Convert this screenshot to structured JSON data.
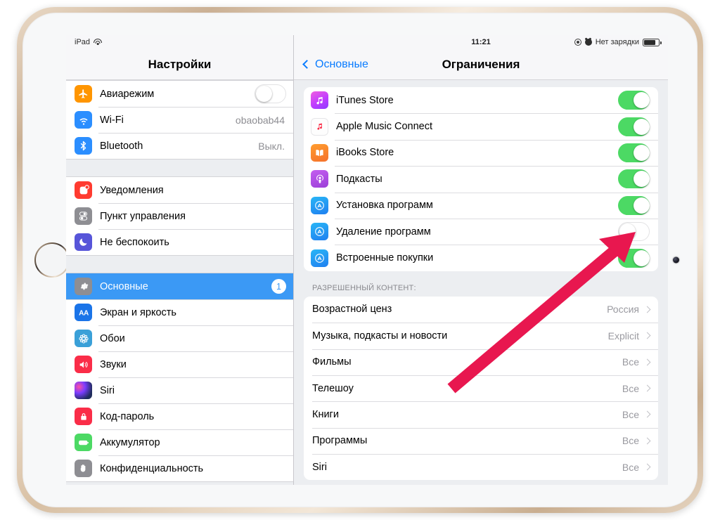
{
  "device": {
    "home_button": "home-button",
    "camera": "front-camera"
  },
  "sidebar": {
    "statusbar": {
      "device_label": "iPad",
      "wifi_icon": "wifi-icon"
    },
    "title": "Настройки",
    "groups": [
      {
        "rows": [
          {
            "label": "Авиарежим",
            "icon": "airplane-icon",
            "control": "toggle",
            "toggle_on": false
          },
          {
            "label": "Wi-Fi",
            "icon": "wifi-icon",
            "control": "value",
            "value": "obaobab44"
          },
          {
            "label": "Bluetooth",
            "icon": "bluetooth-icon",
            "control": "value",
            "value": "Выкл."
          }
        ]
      },
      {
        "rows": [
          {
            "label": "Уведомления",
            "icon": "notifications-icon",
            "control": "none"
          },
          {
            "label": "Пункт управления",
            "icon": "control-center-icon",
            "control": "none"
          },
          {
            "label": "Не беспокоить",
            "icon": "moon-icon",
            "control": "none"
          }
        ]
      },
      {
        "rows": [
          {
            "label": "Основные",
            "icon": "gear-icon",
            "control": "badge",
            "badge": "1",
            "selected": true
          },
          {
            "label": "Экран и яркость",
            "icon": "display-icon",
            "icon_text": "AA",
            "control": "none"
          },
          {
            "label": "Обои",
            "icon": "wallpaper-icon",
            "control": "none"
          },
          {
            "label": "Звуки",
            "icon": "sound-icon",
            "control": "none"
          },
          {
            "label": "Siri",
            "icon": "siri-icon",
            "control": "none"
          },
          {
            "label": "Код-пароль",
            "icon": "lock-icon",
            "control": "none"
          },
          {
            "label": "Аккумулятор",
            "icon": "battery-icon",
            "control": "none"
          },
          {
            "label": "Конфиденциальность",
            "icon": "hand-icon",
            "control": "none"
          }
        ]
      }
    ]
  },
  "detail": {
    "statusbar": {
      "clock": "11:21",
      "location_icon": "location-services-icon",
      "alarm_icon": "alarm-clock-icon",
      "battery_text": "Нет зарядки",
      "battery_icon": "battery-icon",
      "battery_level_pct": 82
    },
    "navbar": {
      "back_label": "Основные",
      "back_icon": "chevron-left-icon",
      "title": "Ограничения"
    },
    "toggle_rows": [
      {
        "label": "iTunes Store",
        "icon": "itunes-store-icon",
        "toggle_on": true
      },
      {
        "label": "Apple Music Connect",
        "icon": "apple-music-icon",
        "toggle_on": true
      },
      {
        "label": "iBooks Store",
        "icon": "ibooks-store-icon",
        "toggle_on": true
      },
      {
        "label": "Подкасты",
        "icon": "podcasts-icon",
        "toggle_on": true
      },
      {
        "label": "Установка программ",
        "icon": "app-store-icon",
        "toggle_on": true
      },
      {
        "label": "Удаление программ",
        "icon": "app-store-icon",
        "toggle_on": false
      },
      {
        "label": "Встроенные покупки",
        "icon": "app-store-icon",
        "toggle_on": true
      }
    ],
    "allowed_section_header": "Разрешенный контент:",
    "allowed_rows": [
      {
        "label": "Возрастной ценз",
        "value": "Россия"
      },
      {
        "label": "Музыка, подкасты и новости",
        "value": "Explicit"
      },
      {
        "label": "Фильмы",
        "value": "Все"
      },
      {
        "label": "Телешоу",
        "value": "Все"
      },
      {
        "label": "Книги",
        "value": "Все"
      },
      {
        "label": "Программы",
        "value": "Все"
      },
      {
        "label": "Siri",
        "value": "Все"
      }
    ]
  },
  "annotation": {
    "arrow_color": "#E8174F",
    "points_to": "Удаление программ"
  },
  "colors": {
    "accent_blue": "#3b99f5",
    "link_blue": "#0a7cff",
    "toggle_on_green": "#4cd964",
    "screen_bg": "#eceef1",
    "arrow_red": "#E8174F"
  }
}
